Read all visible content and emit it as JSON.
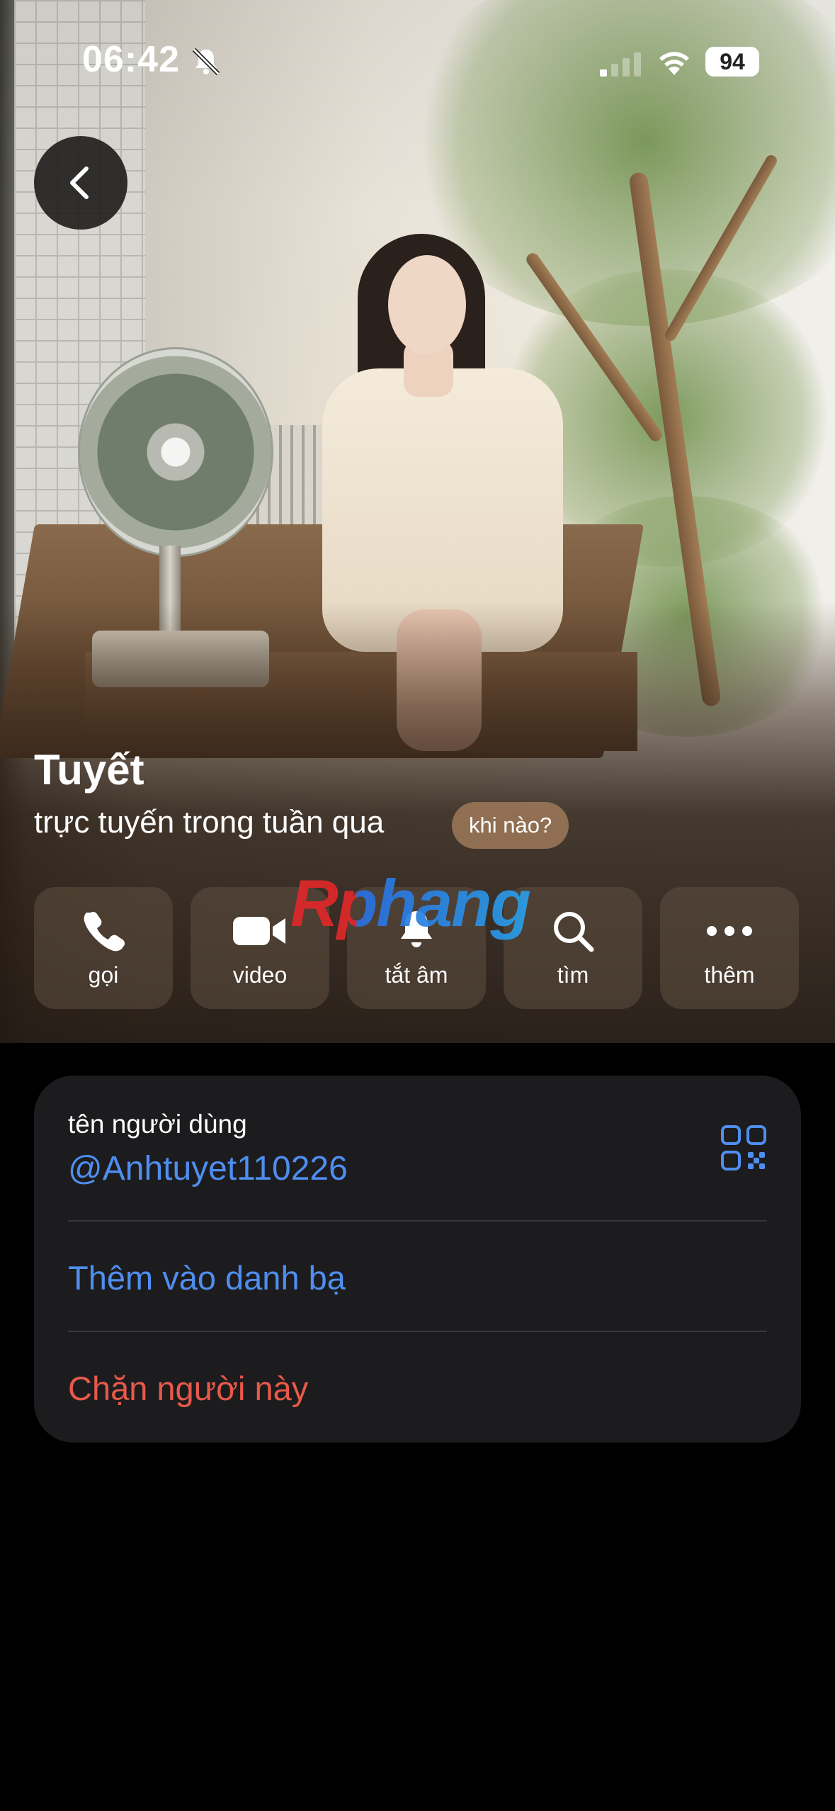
{
  "status_bar": {
    "time": "06:42",
    "battery": "94",
    "icons": [
      "bell-slash-icon",
      "signal-icon",
      "wifi-icon"
    ]
  },
  "header": {
    "back_icon": "chevron-left-icon"
  },
  "profile": {
    "name": "Tuyết",
    "last_seen": "trực tuyến trong tuần qua",
    "when_chip": "khi nào?"
  },
  "actions": [
    {
      "label": "gọi",
      "icon": "phone-icon"
    },
    {
      "label": "video",
      "icon": "video-camera-icon"
    },
    {
      "label": "tắt âm",
      "icon": "bell-icon"
    },
    {
      "label": "tìm",
      "icon": "search-icon"
    },
    {
      "label": "thêm",
      "icon": "more-dots-icon"
    }
  ],
  "watermark": "Rphang",
  "info": {
    "username_caption": "tên người dùng",
    "username": "@Anhtuyet110226",
    "qr_icon": "qr-code-icon",
    "add_contact": "Thêm vào danh bạ",
    "block": "Chặn người này"
  },
  "colors": {
    "link": "#4f8ef0",
    "destructive": "#e8594a",
    "card": "#1c1c1e",
    "background": "#000000"
  }
}
